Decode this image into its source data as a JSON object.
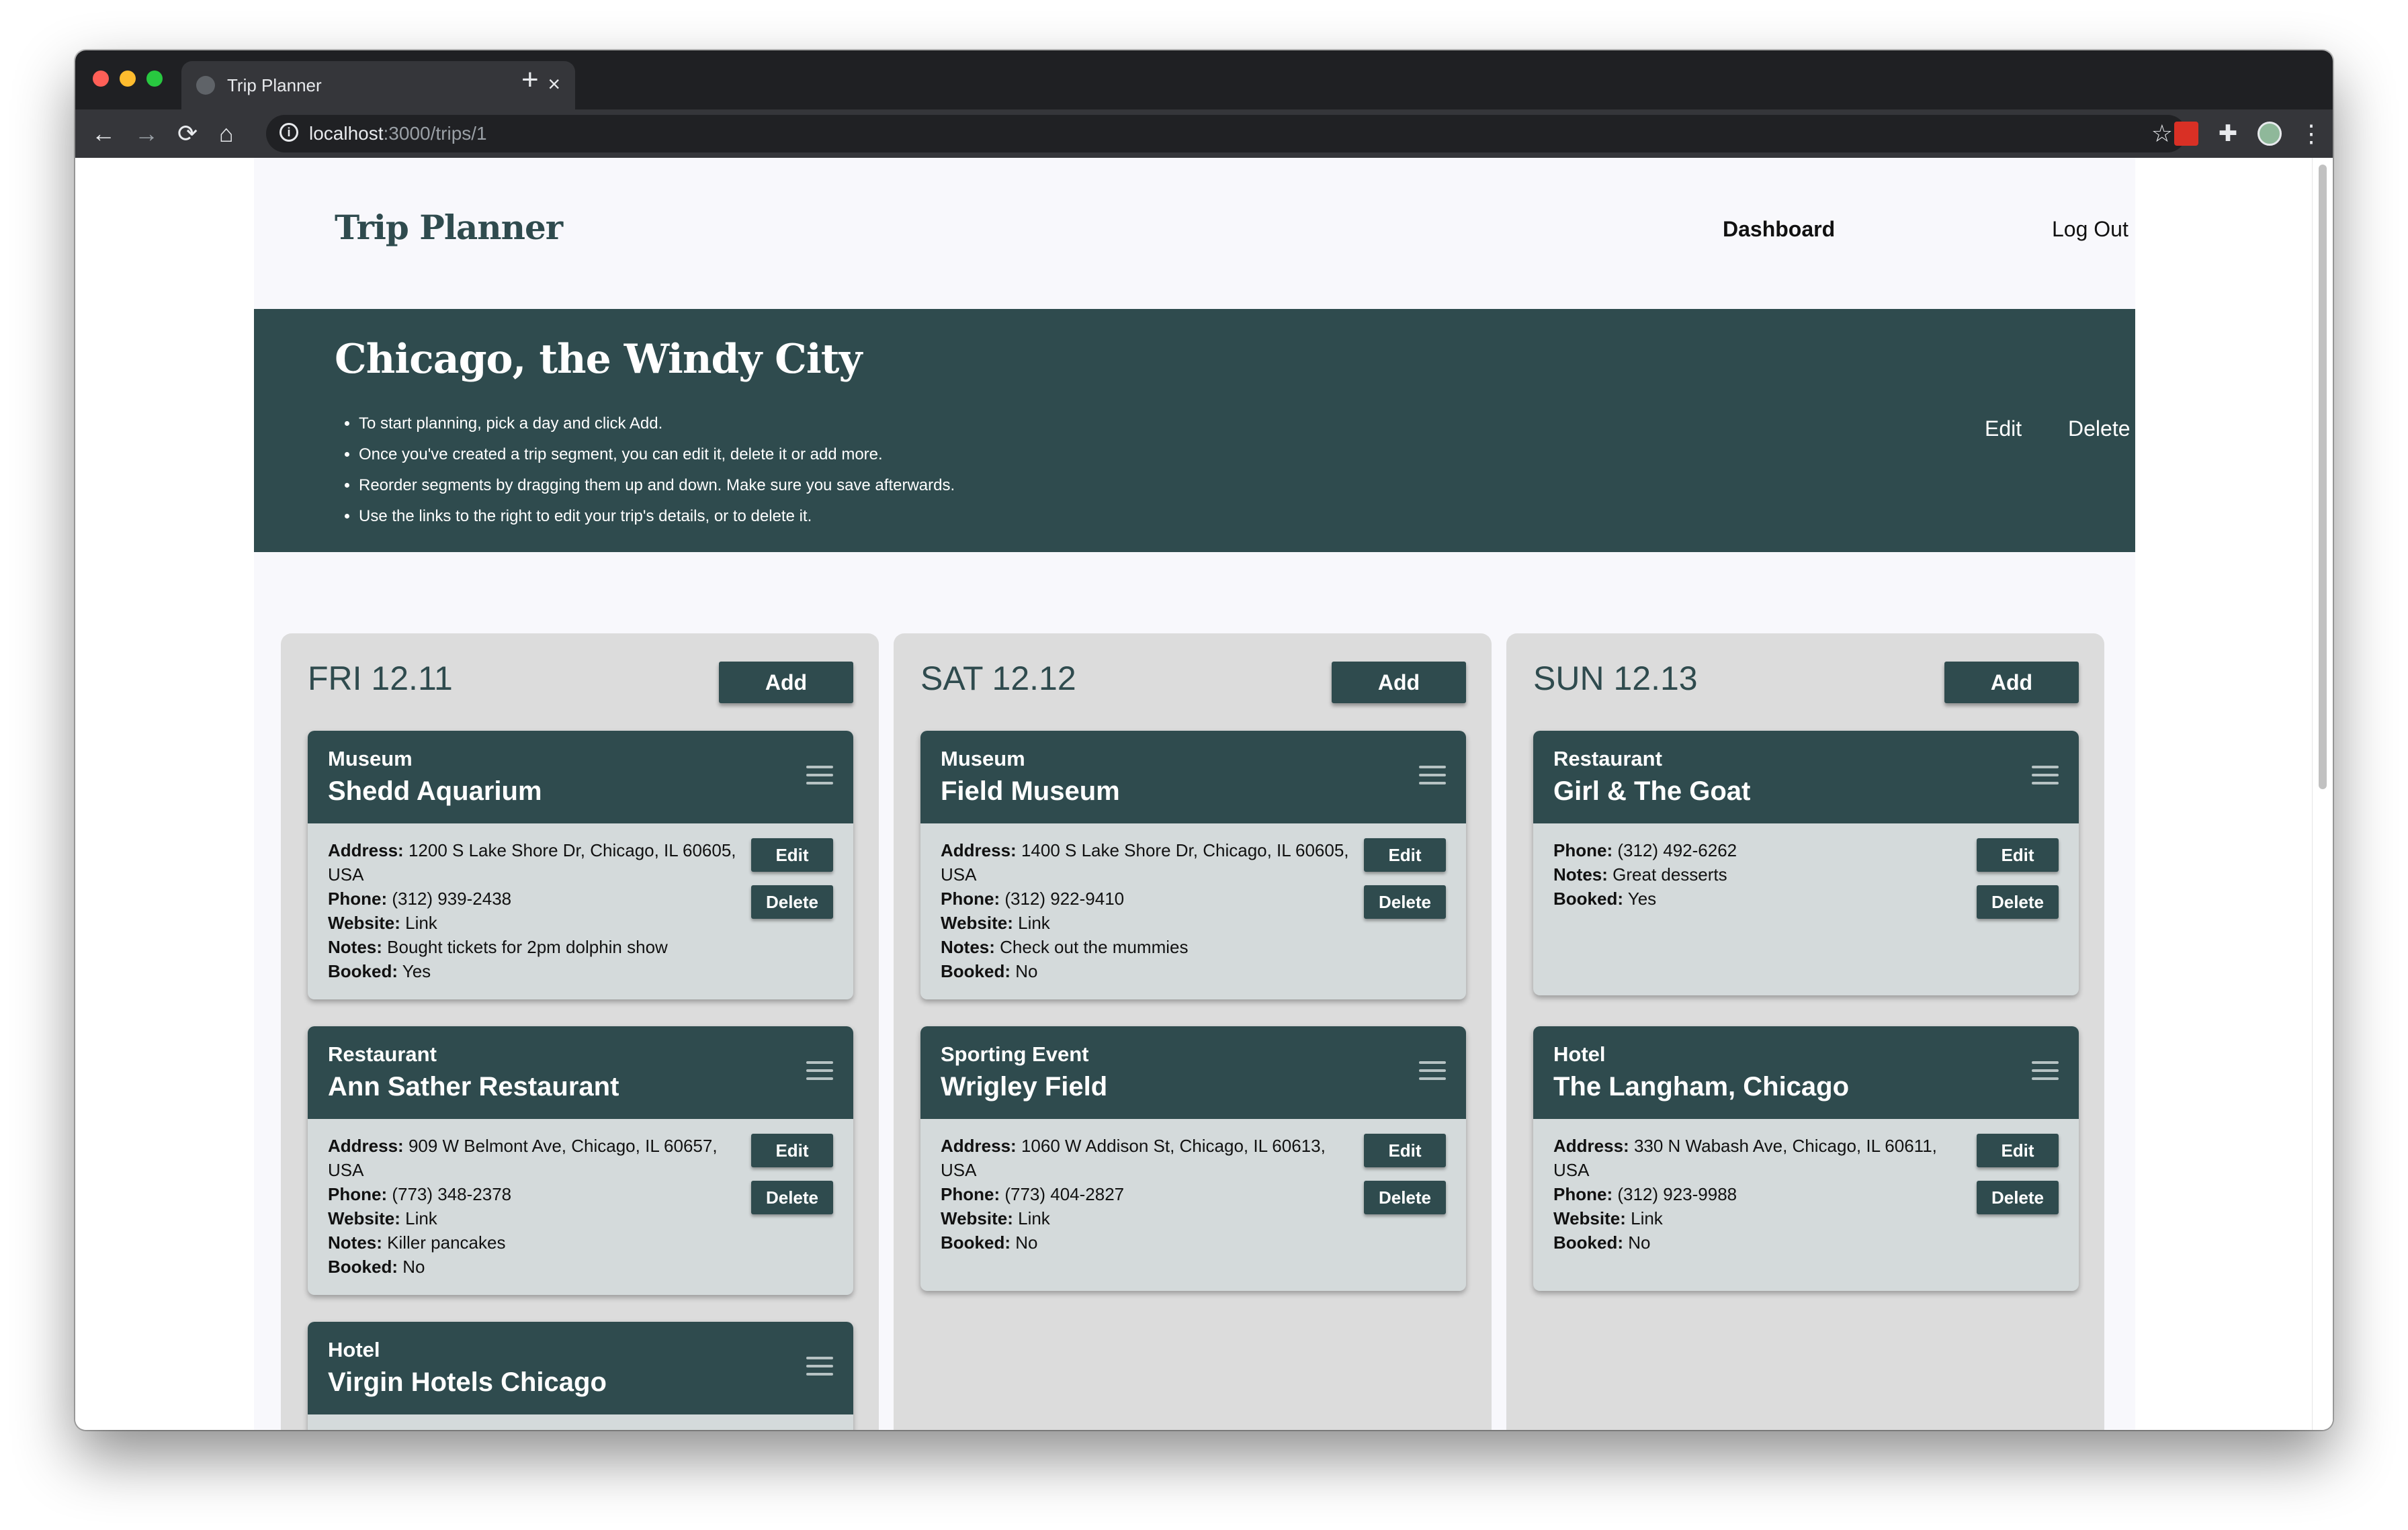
{
  "browser": {
    "tab_title": "Trip Planner",
    "tab_close": "×",
    "new_tab": "+",
    "url_host": "localhost",
    "url_rest": ":3000/trips/1",
    "back": "←",
    "forward": "→",
    "reload": "⟳",
    "home": "⌂",
    "star": "☆",
    "puzzle": "✚",
    "menu": "⋮"
  },
  "header": {
    "brand": "Trip Planner",
    "nav": {
      "dashboard": "Dashboard",
      "logout": "Log Out"
    }
  },
  "hero": {
    "title": "Chicago, the Windy City",
    "tips": [
      "To start planning, pick a day and click Add.",
      "Once you've created a trip segment, you can edit it, delete it or add more.",
      "Reorder segments by dragging them up and down. Make sure you save afterwards.",
      "Use the links to the right to edit your trip's details, or to delete it."
    ],
    "edit": "Edit",
    "delete": "Delete"
  },
  "labels": {
    "add": "Add",
    "edit": "Edit",
    "delete": "Delete",
    "address": "Address:",
    "phone": "Phone:",
    "website": "Website:",
    "notes": "Notes:",
    "booked": "Booked:"
  },
  "days": [
    {
      "title": "FRI 12.11",
      "segments": [
        {
          "type": "Museum",
          "name": "Shedd Aquarium",
          "address": "1200 S Lake Shore Dr, Chicago, IL 60605, USA",
          "phone": "(312) 939-2438",
          "website": "Link",
          "notes": "Bought tickets for 2pm dolphin show",
          "booked": "Yes"
        },
        {
          "type": "Restaurant",
          "name": "Ann Sather Restaurant",
          "address": "909 W Belmont Ave, Chicago, IL 60657, USA",
          "phone": "(773) 348-2378",
          "website": "Link",
          "notes": "Killer pancakes",
          "booked": "No"
        },
        {
          "type": "Hotel",
          "name": "Virgin Hotels Chicago"
        }
      ]
    },
    {
      "title": "SAT 12.12",
      "segments": [
        {
          "type": "Museum",
          "name": "Field Museum",
          "address": "1400 S Lake Shore Dr, Chicago, IL 60605, USA",
          "phone": "(312) 922-9410",
          "website": "Link",
          "notes": "Check out the mummies",
          "booked": "No"
        },
        {
          "type": "Sporting Event",
          "name": "Wrigley Field",
          "address": "1060 W Addison St, Chicago, IL 60613, USA",
          "phone": "(773) 404-2827",
          "website": "Link",
          "booked": "No"
        }
      ]
    },
    {
      "title": "SUN 12.13",
      "segments": [
        {
          "type": "Restaurant",
          "name": "Girl & The Goat",
          "phone": "(312) 492-6262",
          "notes": "Great desserts",
          "booked": "Yes"
        },
        {
          "type": "Hotel",
          "name": "The Langham, Chicago",
          "address": "330 N Wabash Ave, Chicago, IL 60611, USA",
          "phone": "(312) 923-9988",
          "website": "Link",
          "booked": "No"
        }
      ]
    }
  ]
}
